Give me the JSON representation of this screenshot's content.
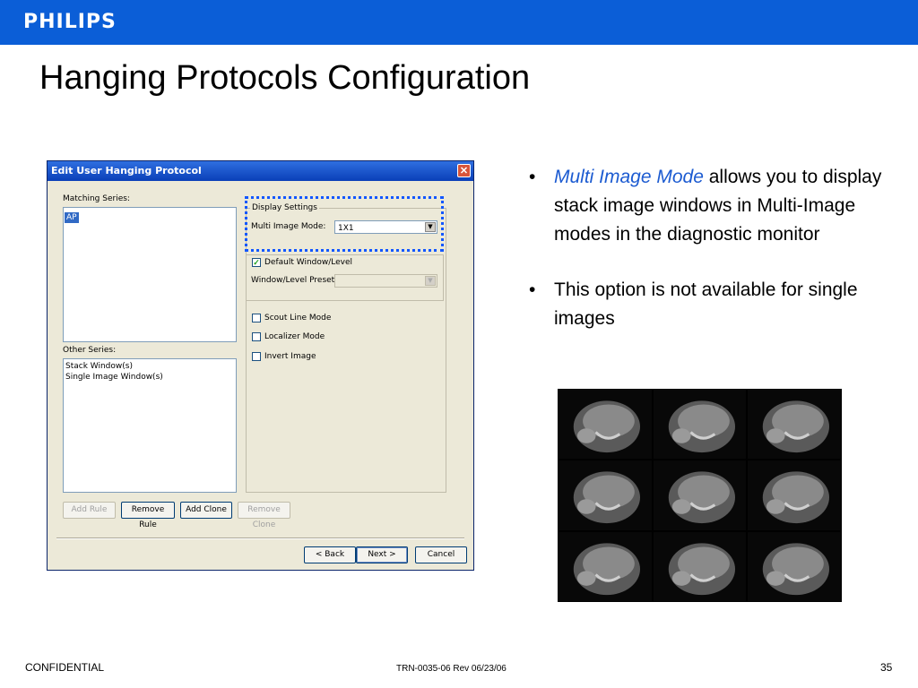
{
  "brand": {
    "logo": "PHILIPS",
    "bar_color": "#0b5ed7"
  },
  "slide": {
    "title": "Hanging Protocols Configuration"
  },
  "dialog": {
    "title": "Edit User Hanging Protocol",
    "close_glyph": "✕",
    "matching_series": {
      "label": "Matching Series:",
      "items": [
        "AP"
      ]
    },
    "other_series": {
      "label": "Other Series:",
      "items": [
        "Stack Window(s)",
        "Single Image Window(s)"
      ]
    },
    "display_settings": {
      "label": "Display Settings",
      "multi_image_mode": {
        "label": "Multi Image Mode:",
        "value": "1X1"
      },
      "default_window_level": {
        "label": "Default Window/Level",
        "checked": true
      },
      "window_level_preset": {
        "label": "Window/Level Preset:",
        "value": ""
      },
      "scout_line_mode": {
        "label": "Scout Line Mode",
        "checked": false
      },
      "localizer_mode": {
        "label": "Localizer Mode",
        "checked": false
      },
      "invert_image": {
        "label": "Invert Image",
        "checked": false
      }
    },
    "buttons": {
      "add_rule": "Add Rule",
      "remove_rule": "Remove Rule",
      "add_clone": "Add Clone",
      "remove_clone": "Remove Clone",
      "back": "< Back",
      "next": "Next >",
      "cancel": "Cancel"
    }
  },
  "bullets": [
    {
      "emphasis": "Multi Image Mode",
      "text": " allows you to display stack image windows in Multi-Image modes in the diagnostic monitor"
    },
    {
      "emphasis": "",
      "text": "This option is not available for single images"
    }
  ],
  "bullet_glyph": "•",
  "footer": {
    "left": "CONFIDENTIAL",
    "center": "TRN-0035-06 Rev 06/23/06",
    "page": "35"
  },
  "colors": {
    "highlight": "#1257ff",
    "emphasis": "#1c5bd1"
  }
}
